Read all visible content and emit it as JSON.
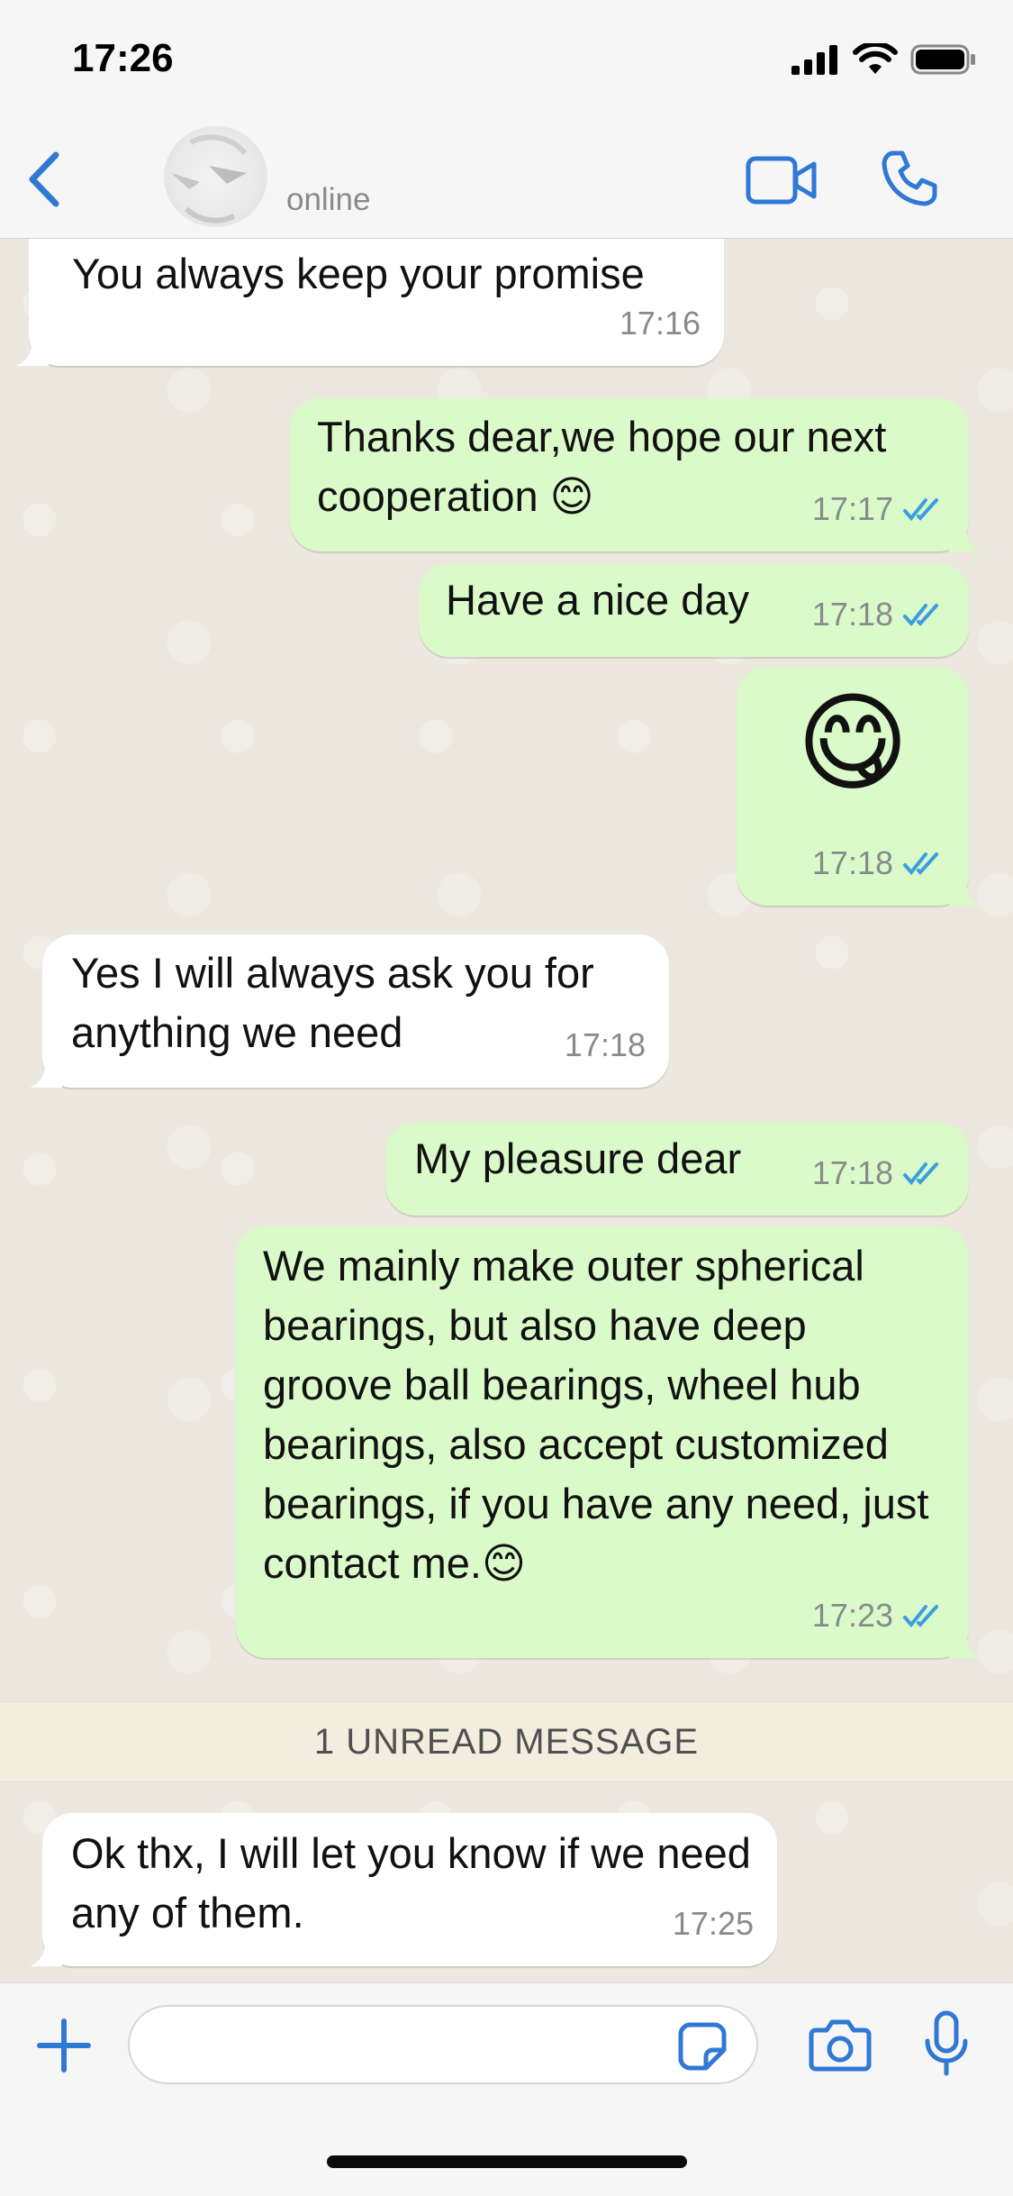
{
  "status_bar": {
    "time": "17:26"
  },
  "header": {
    "back_icon": "chevron-left-icon",
    "status": "online",
    "accent_color": "#2f78d4"
  },
  "messages": [
    {
      "direction": "in",
      "text": "You always keep your promise",
      "time": "17:16"
    },
    {
      "direction": "out",
      "text": "Thanks dear,we hope our next cooperation 😊",
      "time": "17:17",
      "read": true
    },
    {
      "direction": "out",
      "text": "Have a nice day",
      "time": "17:18",
      "read": true
    },
    {
      "direction": "out",
      "text": "😋",
      "time": "17:18",
      "read": true
    },
    {
      "direction": "in",
      "text": "Yes I will always ask you for anything we need",
      "time": "17:18"
    },
    {
      "direction": "out",
      "text": "My pleasure dear",
      "time": "17:18",
      "read": true
    },
    {
      "direction": "out",
      "text": "We mainly make outer spherical bearings, but also have deep groove ball bearings, wheel hub bearings, also accept customized bearings, if you have any need, just contact me.😊",
      "time": "17:23",
      "read": true
    },
    {
      "direction": "in",
      "text": "Ok thx, I will let you know if we need any of them.",
      "time": "17:25"
    }
  ],
  "unread_banner": "1 UNREAD MESSAGE",
  "composer": {
    "value": ""
  },
  "colors": {
    "incoming": "#ffffff",
    "outgoing": "#dbfac9",
    "read_ticks": "#3a9fe0"
  }
}
